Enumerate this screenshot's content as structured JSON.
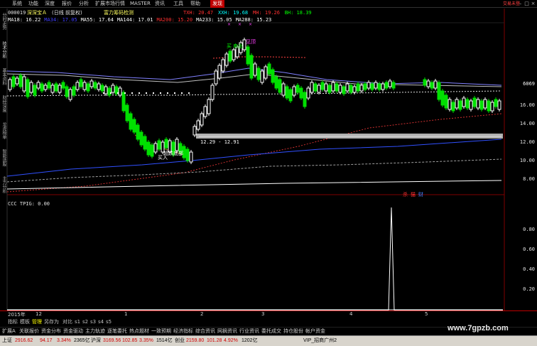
{
  "menu": [
    "系统",
    "功能",
    "深度",
    "报价",
    "分析",
    "扩展市场行情",
    "MASTER",
    "资讯",
    "工具",
    "帮助"
  ],
  "menu_discover": "发现",
  "login_hint": "交易未登",
  "left_tabs": [
    "分时走势",
    "技术分析",
    "基本资料",
    "财经深度",
    "龙虎榜单",
    "智能选股",
    "主力分析"
  ],
  "header": {
    "code": "000019",
    "name": "深深宝Ａ",
    "period": "(日线 前复权)",
    "indicator": "富力筹码检测",
    "ma_row": [
      {
        "label": "MA18:",
        "value": "16.22",
        "color": "#ffffff"
      },
      {
        "label": "MA34:",
        "value": "17.05",
        "color": "#4040ff"
      },
      {
        "label": "MA55:",
        "value": "17.64",
        "color": "#ffffff"
      },
      {
        "label": "MA144:",
        "value": "17.01",
        "color": "#ffffff"
      },
      {
        "label": "MA200:",
        "value": "15.20",
        "color": "#ff3030"
      },
      {
        "label": "MA233:",
        "value": "15.05",
        "color": "#ffffff"
      },
      {
        "label": "MA288:",
        "value": "15.23",
        "color": "#ffffff"
      }
    ],
    "upper_row": [
      {
        "label": "TXH:",
        "value": "20.47",
        "color": "#ff3030"
      },
      {
        "label": "XXH:",
        "value": "19.68",
        "color": "#00ffff"
      },
      {
        "label": "MH:",
        "value": "19.26",
        "color": "#ff3030"
      },
      {
        "label": "BH:",
        "value": "18.39",
        "color": "#00ff00"
      }
    ]
  },
  "axis": {
    "top_value": "6069",
    "price_labels": [
      "16.00",
      "14.00",
      "12.00",
      "10.00",
      "8.00"
    ],
    "lower_labels": [
      "0.80",
      "0.60",
      "0.40",
      "0.20"
    ]
  },
  "annotations": {
    "buy": "买",
    "sell": "卖出",
    "peak": "见顶",
    "bottom": "超跌底部",
    "buy2": "买入",
    "range": "12.29 - 12.91"
  },
  "lower_header": "CCC TPIG: 0.00",
  "red_badges": [
    "杀",
    "猫",
    "财"
  ],
  "x_axis": {
    "year": "2015年",
    "labels": [
      "12",
      "1",
      "2",
      "3",
      "4",
      "5"
    ]
  },
  "indicator_tabs": [
    "指标",
    "模板",
    "管理",
    "另存为",
    "对比",
    "s1",
    "s2",
    "s3",
    "s4",
    "s5"
  ],
  "func_tabs": [
    "扩展A",
    "关联报价",
    "资金分布",
    "资金驱动",
    "主力轨迹",
    "逐笔委托",
    "热点题材",
    "一致预期",
    "经济指标",
    "综合资讯",
    "网摘资讯",
    "行业资讯",
    "委托成交",
    "持仓股份",
    "帐户资金"
  ],
  "status": {
    "sh_label": "上证",
    "sh_value": "2916.62",
    "sh_change": "94.17",
    "sh_pct": "3.34%",
    "sh_amount": "2365亿",
    "hs_label": "沪深",
    "hs_value": "3169.56",
    "hs_change": "102.85",
    "hs_pct": "3.35%",
    "hs_amount": "1514亿",
    "cy_label": "创业",
    "cy_value": "2159.80",
    "cy_change": "101.28",
    "cy_pct": "4.92%",
    "cy_amount": "1202亿",
    "vip": "VIP_招商广州2"
  },
  "watermark": "www.7gpzb.com",
  "colors": {
    "up": "#ffffff",
    "down": "#00e000",
    "ma_red": "#d03030",
    "ma_blue": "#3050ff",
    "band_gray": "#c0c0c0",
    "grid_red": "#800000"
  }
}
